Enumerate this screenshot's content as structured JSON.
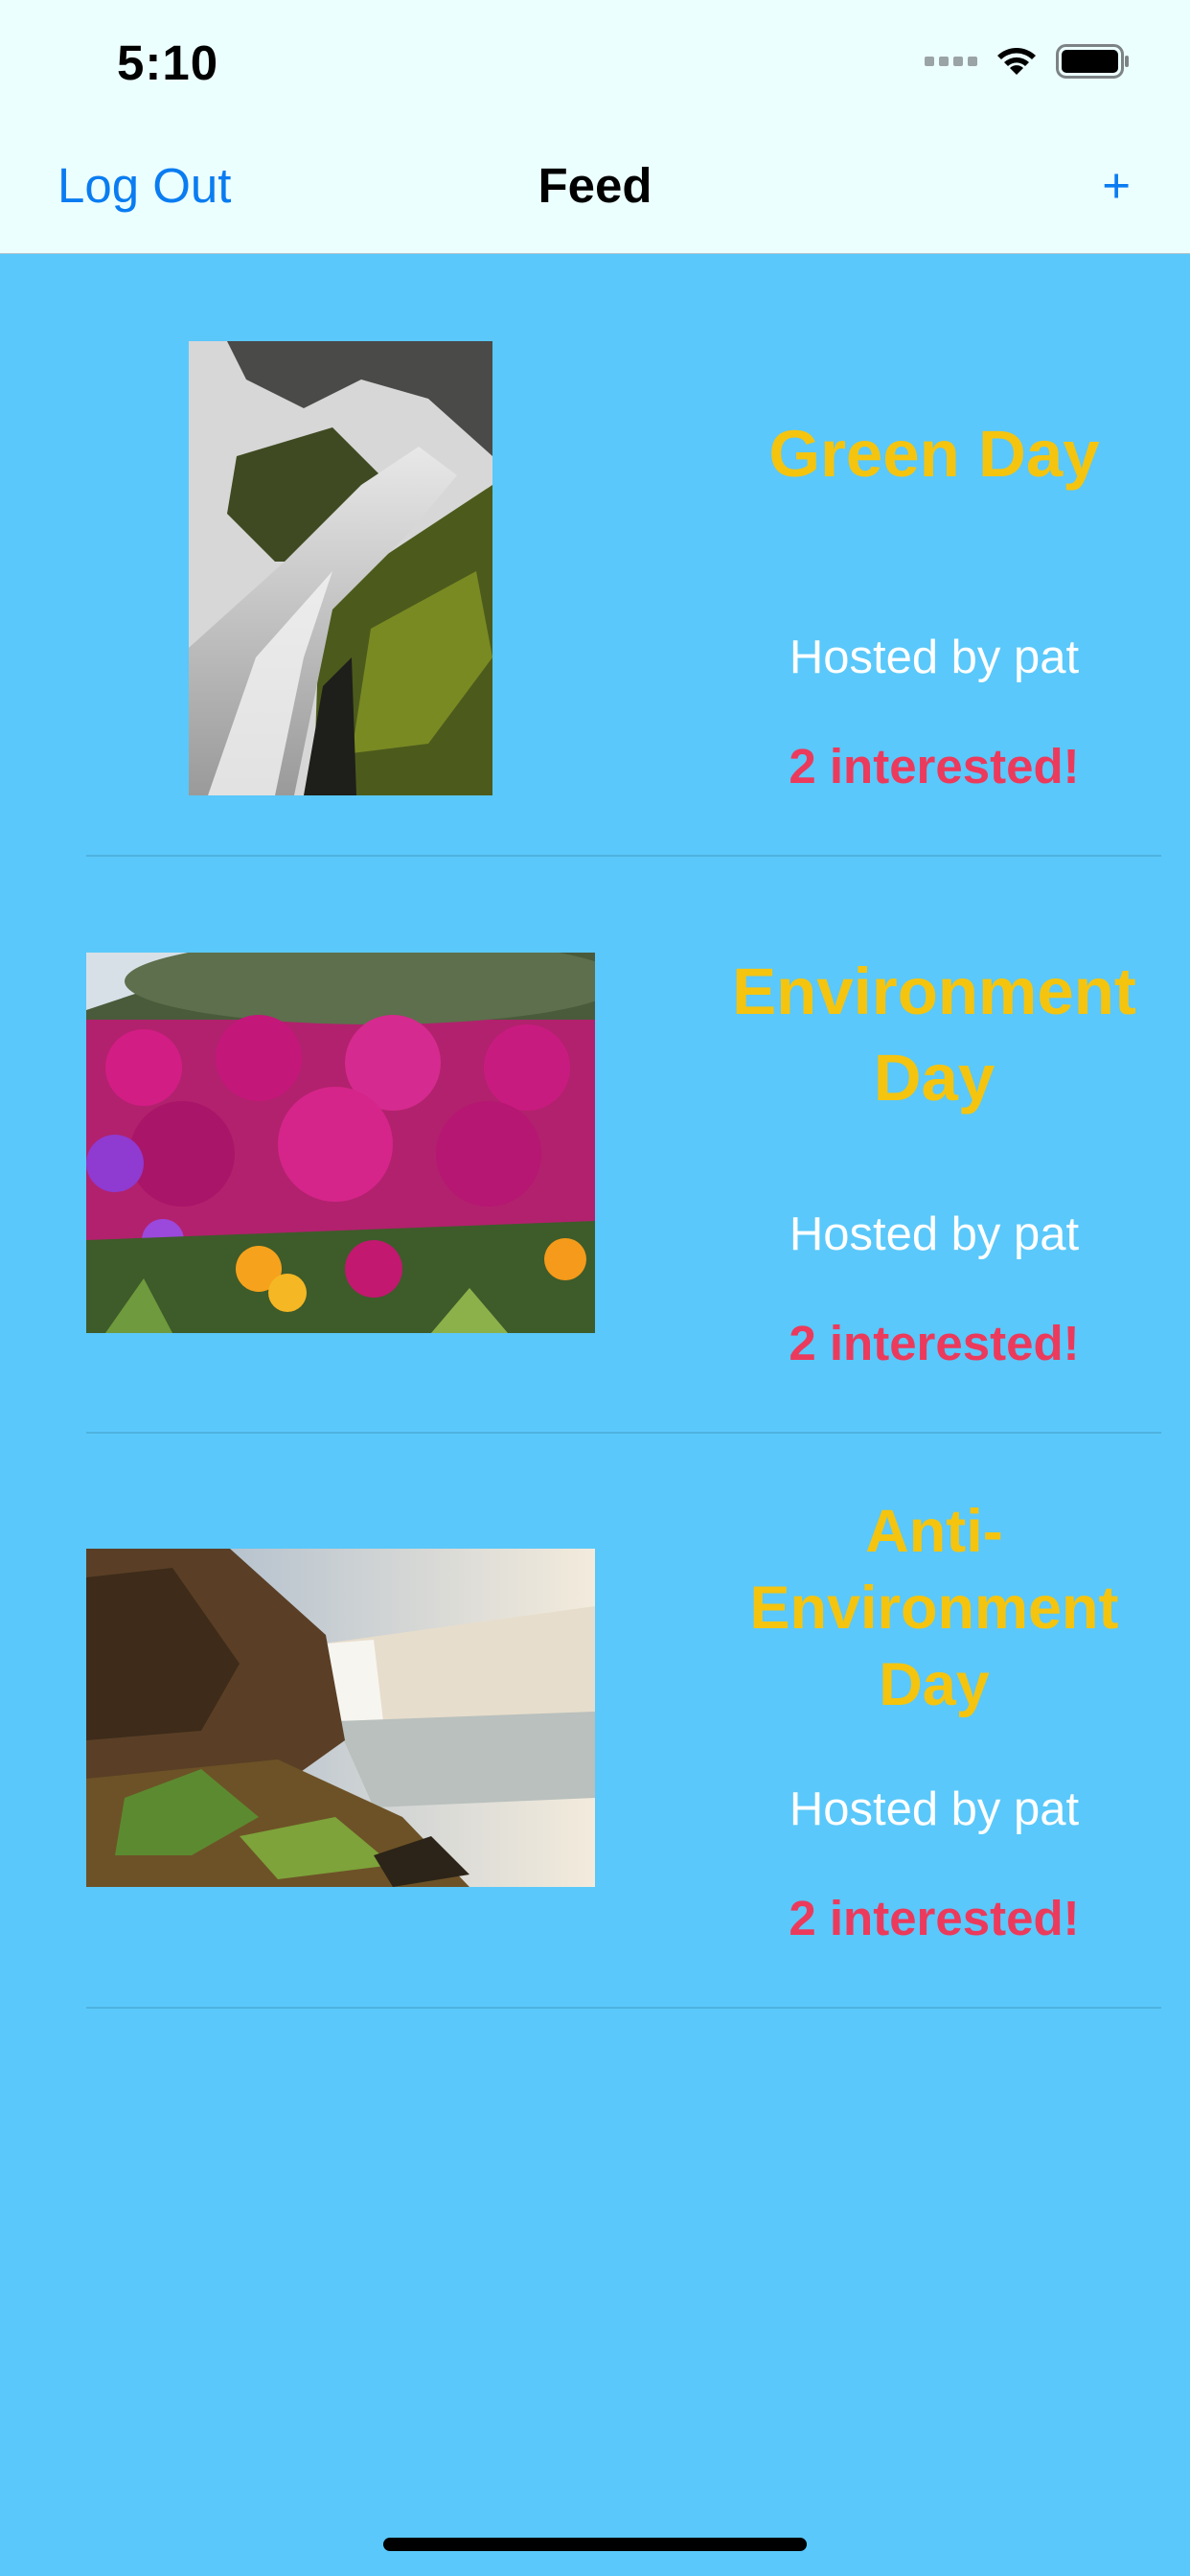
{
  "status_bar": {
    "time": "5:10"
  },
  "nav": {
    "left_label": "Log Out",
    "title": "Feed",
    "right_label": "+"
  },
  "colors": {
    "background": "#5ac8fa",
    "nav_background": "#ecffff",
    "title": "#f5c40f",
    "host": "#ffffff",
    "interested": "#ec3a5c",
    "link": "#0a7cf1"
  },
  "events": [
    {
      "title": "Green Day",
      "host": "Hosted by pat",
      "interested": "2 interested!",
      "image": "waterfall-rocks-image"
    },
    {
      "title": "Environment\nDay",
      "host": "Hosted by pat",
      "interested": "2 interested!",
      "image": "flowers-image"
    },
    {
      "title": "Anti-\nEnvironment\nDay",
      "host": "Hosted by pat",
      "interested": "2 interested!",
      "image": "waterfall-cliff-image"
    }
  ]
}
